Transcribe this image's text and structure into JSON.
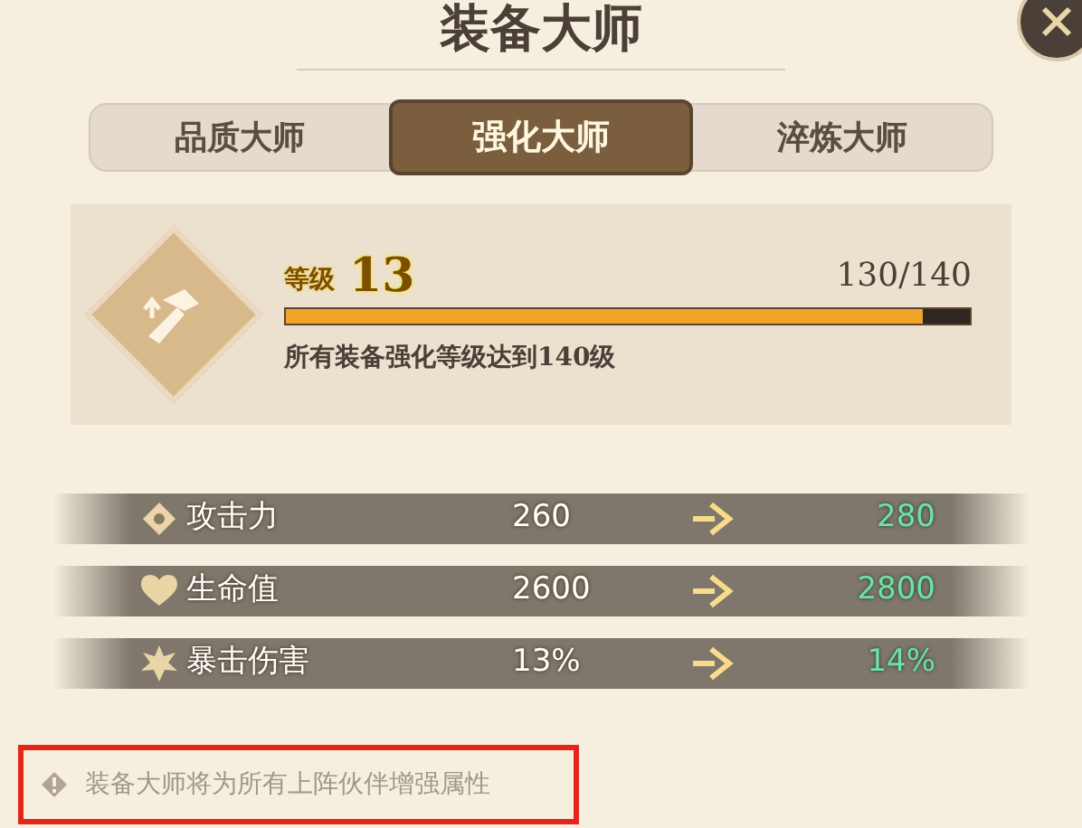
{
  "title": "装备大师",
  "tabs": [
    {
      "label": "品质大师",
      "selected": false
    },
    {
      "label": "强化大师",
      "selected": true
    },
    {
      "label": "淬炼大师",
      "selected": false
    }
  ],
  "level_card": {
    "level_label": "等级",
    "level_value": "13",
    "progress_text": "130/140",
    "level": 0.93,
    "requirement": "所有装备强化等级达到140级"
  },
  "stats": [
    {
      "kind": "attack",
      "name": "攻击力",
      "current": "260",
      "next": "280"
    },
    {
      "kind": "health",
      "name": "生命值",
      "current": "2600",
      "next": "2800"
    },
    {
      "kind": "crit",
      "name": "暴击伤害",
      "current": "13%",
      "next": "14%"
    }
  ],
  "note": {
    "text": "装备大师将为所有上阵伙伴增强属性",
    "highlighted": true
  }
}
